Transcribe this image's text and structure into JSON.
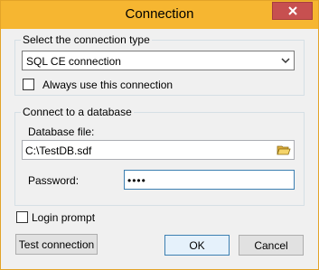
{
  "window": {
    "title": "Connection"
  },
  "connection_type": {
    "legend": "Select the connection type",
    "selected": "SQL CE connection",
    "always_use_label": "Always use this connection",
    "always_use_checked": false
  },
  "database": {
    "legend": "Connect to a database",
    "file_label": "Database file:",
    "file_value": "C:\\TestDB.sdf",
    "password_label": "Password:",
    "password_value": "••••"
  },
  "login_prompt": {
    "label": "Login prompt",
    "checked": false
  },
  "buttons": {
    "test": "Test connection",
    "ok": "OK",
    "cancel": "Cancel"
  },
  "colors": {
    "titlebar": "#f6b631",
    "close": "#c75050",
    "focus_border": "#3c7fb1"
  },
  "icons": {
    "close": "close-icon",
    "folder": "folder-open-icon",
    "dropdown": "chevron-down-icon"
  }
}
